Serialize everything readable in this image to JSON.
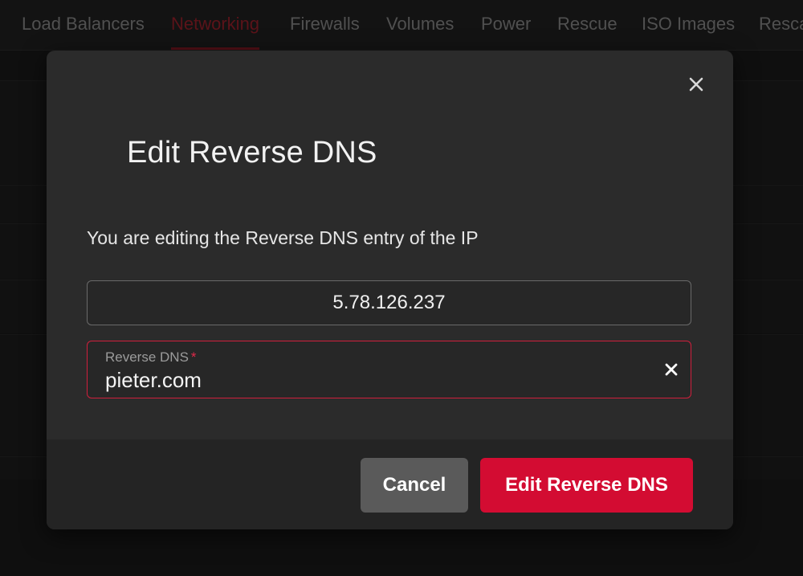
{
  "tabs": [
    {
      "label": "Load Balancers",
      "active": false
    },
    {
      "label": "Networking",
      "active": true
    },
    {
      "label": "Firewalls",
      "active": false
    },
    {
      "label": "Volumes",
      "active": false
    },
    {
      "label": "Power",
      "active": false
    },
    {
      "label": "Rescue",
      "active": false
    },
    {
      "label": "ISO Images",
      "active": false
    },
    {
      "label": "Rescale",
      "active": false
    }
  ],
  "modal": {
    "title": "Edit Reverse DNS",
    "description": "You are editing the Reverse DNS entry of the IP",
    "ip_address": "5.78.126.237",
    "dns_field": {
      "label": "Reverse DNS",
      "required_marker": "*",
      "value": "pieter.com"
    },
    "cancel_label": "Cancel",
    "submit_label": "Edit Reverse DNS"
  },
  "icons": {
    "close": "close-icon",
    "clear": "clear-icon"
  },
  "colors": {
    "accent": "#d30c32",
    "active_tab": "#7a1a22",
    "modal_bg": "#2b2b2b",
    "footer_bg": "#242424",
    "cancel_bg": "#5a5a5a"
  }
}
